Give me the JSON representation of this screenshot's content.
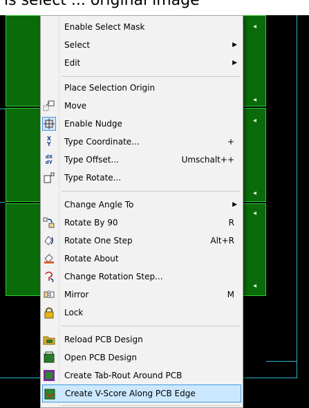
{
  "window": {
    "title_fragment": "is select ... original image"
  },
  "menu": {
    "items": [
      {
        "label": "Enable Select Mask",
        "shortcut": "",
        "submenu": false,
        "icon": ""
      },
      {
        "label": "Select",
        "shortcut": "",
        "submenu": true,
        "icon": ""
      },
      {
        "label": "Edit",
        "shortcut": "",
        "submenu": true,
        "icon": ""
      },
      {
        "label": "Place Selection Origin",
        "shortcut": "",
        "submenu": false,
        "icon": ""
      },
      {
        "label": "Move",
        "shortcut": "",
        "submenu": false,
        "icon": "move-icon"
      },
      {
        "label": "Enable Nudge",
        "shortcut": "",
        "submenu": false,
        "icon": "nudge-icon"
      },
      {
        "label": "Type Coordinate...",
        "shortcut": "+",
        "submenu": false,
        "icon": "xy-coordinate-icon"
      },
      {
        "label": "Type Offset...",
        "shortcut": "Umschalt++",
        "submenu": false,
        "icon": "dxdy-offset-icon"
      },
      {
        "label": "Type Rotate...",
        "shortcut": "",
        "submenu": false,
        "icon": "rotate-box-icon"
      },
      {
        "label": "Change Angle To",
        "shortcut": "",
        "submenu": true,
        "icon": ""
      },
      {
        "label": "Rotate By 90",
        "shortcut": "R",
        "submenu": false,
        "icon": "rotate-90-icon"
      },
      {
        "label": "Rotate One Step",
        "shortcut": "Alt+R",
        "submenu": false,
        "icon": "rotate-step-icon"
      },
      {
        "label": "Rotate About",
        "shortcut": "",
        "submenu": false,
        "icon": "rotate-about-icon"
      },
      {
        "label": "Change Rotation Step...",
        "shortcut": "",
        "submenu": false,
        "icon": "rotation-step-icon"
      },
      {
        "label": "Mirror",
        "shortcut": "M",
        "submenu": false,
        "icon": "mirror-icon"
      },
      {
        "label": "Lock",
        "shortcut": "",
        "submenu": false,
        "icon": "lock-icon"
      },
      {
        "label": "Reload PCB Design",
        "shortcut": "",
        "submenu": false,
        "icon": "reload-pcb-icon"
      },
      {
        "label": "Open PCB Design",
        "shortcut": "",
        "submenu": false,
        "icon": "open-pcb-icon"
      },
      {
        "label": "Create Tab-Rout Around PCB",
        "shortcut": "",
        "submenu": false,
        "icon": "tab-rout-icon"
      },
      {
        "label": "Create V-Score Along PCB Edge",
        "shortcut": "",
        "submenu": false,
        "icon": "v-score-icon"
      }
    ]
  },
  "colors": {
    "board_fill": "#0a6b0a",
    "board_edge": "#2ecc2e",
    "outline_cyan": "#27b6d0",
    "menu_bg": "#f2f2f2",
    "highlight_bg": "#cce8ff",
    "highlight_border": "#3d9ae0"
  }
}
